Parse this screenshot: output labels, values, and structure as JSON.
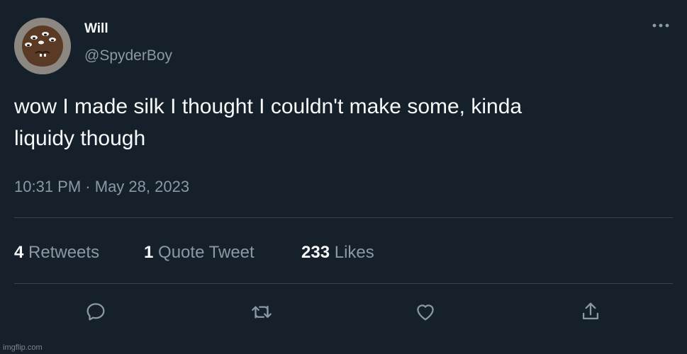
{
  "tweet": {
    "author": {
      "display_name": "Will",
      "handle": "@SpyderBoy"
    },
    "text": "wow I made silk I thought I couldn't make some, kinda\nliquidy though",
    "time": "10:31 PM",
    "separator": "·",
    "date": "May 28, 2023"
  },
  "stats": {
    "retweets": {
      "count": "4",
      "label": "Retweets"
    },
    "quote_tweets": {
      "count": "1",
      "label": "Quote Tweet"
    },
    "likes": {
      "count": "233",
      "label": "Likes"
    }
  },
  "actions": [
    "reply-icon",
    "retweet-icon",
    "like-icon",
    "share-icon"
  ],
  "watermark": "imgflip.com",
  "colors": {
    "background": "#15202b",
    "primary_text": "#f7f9f9",
    "secondary_text": "#8b98a5",
    "divider": "#38444d"
  }
}
